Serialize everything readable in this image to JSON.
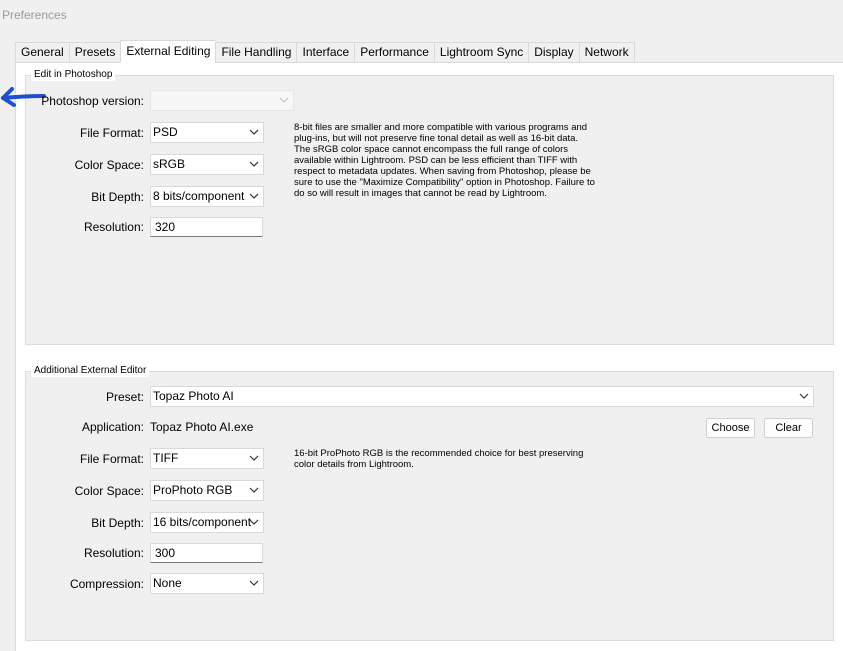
{
  "window": {
    "title": "Preferences"
  },
  "tabs": [
    {
      "label": "General"
    },
    {
      "label": "Presets"
    },
    {
      "label": "External Editing"
    },
    {
      "label": "File Handling"
    },
    {
      "label": "Interface"
    },
    {
      "label": "Performance"
    },
    {
      "label": "Lightroom Sync"
    },
    {
      "label": "Display"
    },
    {
      "label": "Network"
    }
  ],
  "edit_in_photoshop": {
    "group_label": "Edit in Photoshop",
    "photoshop_version": {
      "label": "Photoshop version:",
      "value": ""
    },
    "file_format": {
      "label": "File Format:",
      "value": "PSD"
    },
    "color_space": {
      "label": "Color Space:",
      "value": "sRGB"
    },
    "bit_depth": {
      "label": "Bit Depth:",
      "value": "8 bits/component"
    },
    "resolution": {
      "label": "Resolution:",
      "value": "320"
    },
    "note_lines": [
      "8-bit files are smaller and more compatible with various programs and",
      "plug-ins, but will not preserve fine tonal detail as well as 16-bit data.",
      "The sRGB color space cannot encompass the full range of colors",
      "available within Lightroom. PSD can be less efficient than TIFF with",
      "respect to metadata updates. When saving from Photoshop, please be",
      "sure to use the \"Maximize Compatibility\" option in Photoshop. Failure to",
      "do so will result in images that cannot be read by Lightroom."
    ]
  },
  "additional_editor": {
    "group_label": "Additional External Editor",
    "preset": {
      "label": "Preset:",
      "value": "Topaz Photo AI"
    },
    "application": {
      "label": "Application:",
      "value": "Topaz Photo AI.exe"
    },
    "choose_label": "Choose",
    "clear_label": "Clear",
    "file_format": {
      "label": "File Format:",
      "value": "TIFF"
    },
    "color_space": {
      "label": "Color Space:",
      "value": "ProPhoto RGB"
    },
    "bit_depth": {
      "label": "Bit Depth:",
      "value": "16 bits/component"
    },
    "resolution": {
      "label": "Resolution:",
      "value": "300"
    },
    "compression": {
      "label": "Compression:",
      "value": "None"
    },
    "note_lines": [
      "16-bit ProPhoto RGB is the recommended choice for best preserving",
      "color details from Lightroom."
    ]
  },
  "colors": {
    "arrow": "#1f4fd1"
  }
}
